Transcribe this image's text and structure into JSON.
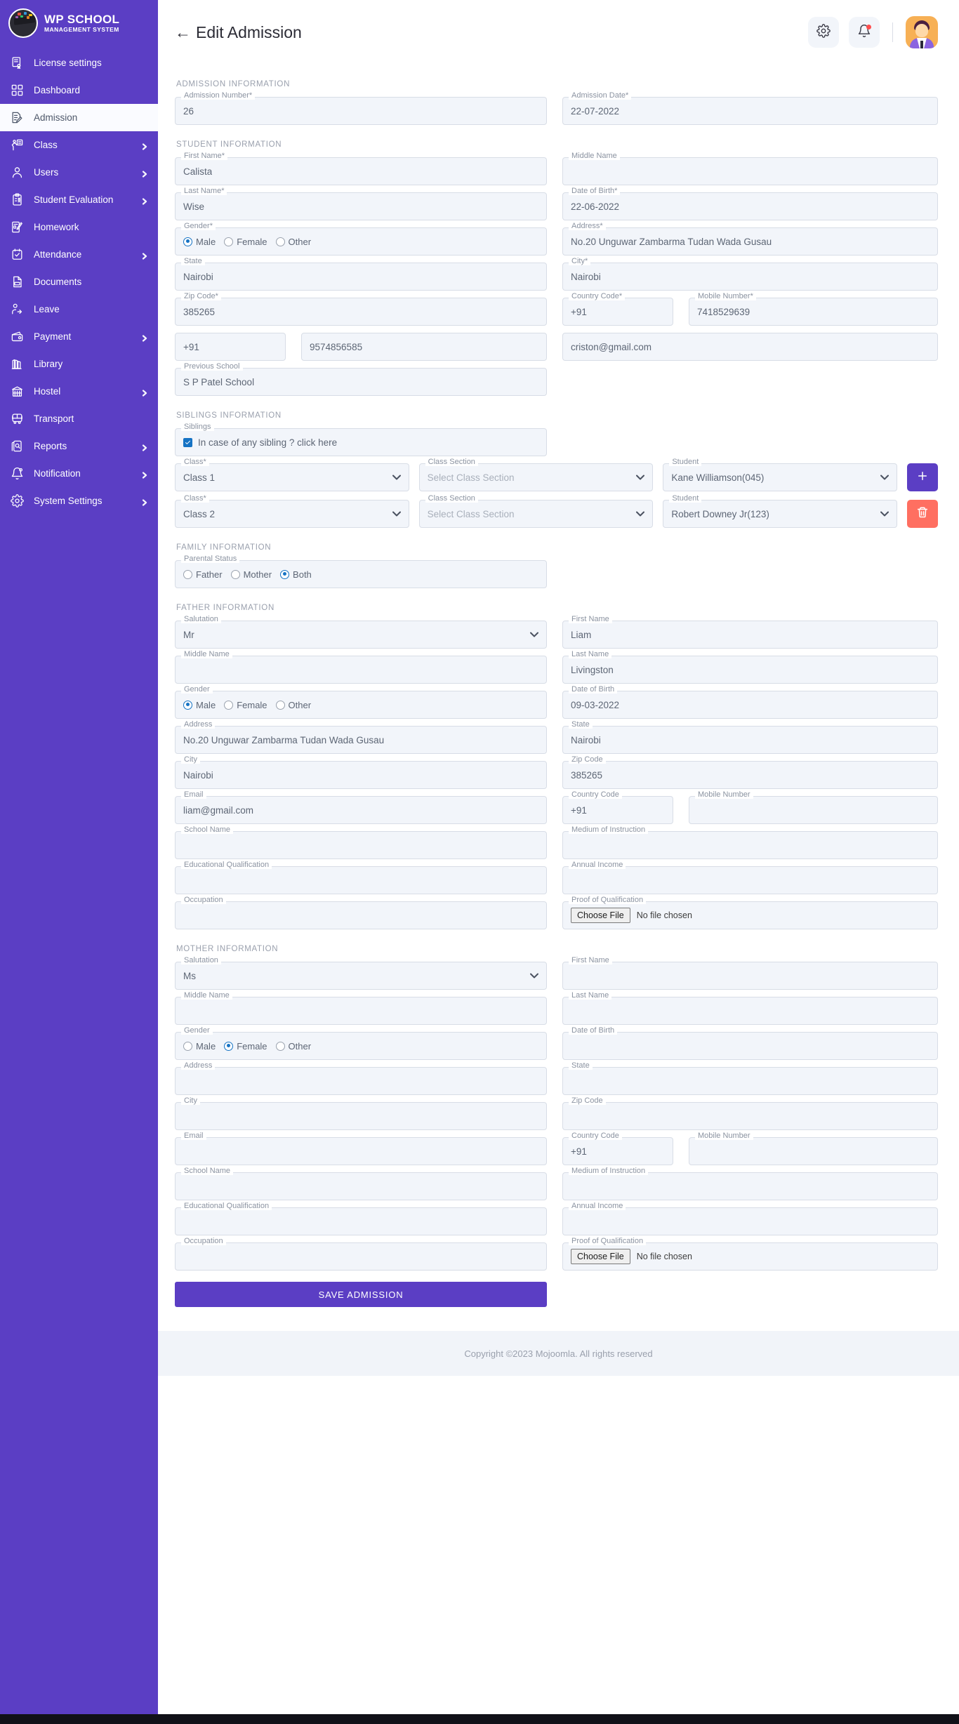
{
  "brand": {
    "title": "WP SCHOOL",
    "subtitle": "MANAGEMENT SYSTEM"
  },
  "sidebar": {
    "items": [
      {
        "label": "License settings",
        "icon": "certificate-icon",
        "chevron": false,
        "active": false
      },
      {
        "label": "Dashboard",
        "icon": "grid-icon",
        "chevron": false,
        "active": false
      },
      {
        "label": "Admission",
        "icon": "admission-form-icon",
        "chevron": false,
        "active": true
      },
      {
        "label": "Class",
        "icon": "class-icon",
        "chevron": true,
        "active": false
      },
      {
        "label": "Users",
        "icon": "user-icon",
        "chevron": true,
        "active": false
      },
      {
        "label": "Student Evaluation",
        "icon": "clipboard-check-icon",
        "chevron": true,
        "active": false
      },
      {
        "label": "Homework",
        "icon": "homework-icon",
        "chevron": false,
        "active": false
      },
      {
        "label": "Attendance",
        "icon": "attendance-icon",
        "chevron": true,
        "active": false
      },
      {
        "label": "Documents",
        "icon": "document-icon",
        "chevron": false,
        "active": false
      },
      {
        "label": "Leave",
        "icon": "leave-icon",
        "chevron": false,
        "active": false
      },
      {
        "label": "Payment",
        "icon": "wallet-icon",
        "chevron": true,
        "active": false
      },
      {
        "label": "Library",
        "icon": "library-icon",
        "chevron": false,
        "active": false
      },
      {
        "label": "Hostel",
        "icon": "hostel-icon",
        "chevron": true,
        "active": false
      },
      {
        "label": "Transport",
        "icon": "bus-icon",
        "chevron": false,
        "active": false
      },
      {
        "label": "Reports",
        "icon": "reports-icon",
        "chevron": true,
        "active": false
      },
      {
        "label": "Notification",
        "icon": "bell-icon",
        "chevron": true,
        "active": false
      },
      {
        "label": "System Settings",
        "icon": "gear-icon",
        "chevron": true,
        "active": false
      }
    ]
  },
  "header": {
    "title": "Edit Admission",
    "back_arrow": "←",
    "settings_icon": "gear-icon",
    "notification_icon": "bell-icon",
    "avatar": "user-avatar"
  },
  "sections": {
    "admission": "ADMISSION INFORMATION",
    "student": "STUDENT INFORMATION",
    "siblings": "SIBLINGS INFORMATION",
    "family": "FAMILY INFORMATION",
    "father": "FATHER INFORMATION",
    "mother": "MOTHER INFORMATION"
  },
  "admission": {
    "number_label": "Admission Number*",
    "number_value": "26",
    "date_label": "Admission Date*",
    "date_value": "22-07-2022"
  },
  "student": {
    "first_name_label": "First Name*",
    "first_name_value": "Calista",
    "middle_name_label": "Middle Name",
    "middle_name_value": "",
    "last_name_label": "Last Name*",
    "last_name_value": "Wise",
    "dob_label": "Date of Birth*",
    "dob_value": "22-06-2022",
    "gender_label": "Gender*",
    "gender_options": [
      "Male",
      "Female",
      "Other"
    ],
    "gender_selected": "Male",
    "address_label": "Address*",
    "address_value": "No.20 Unguwar Zambarma Tudan Wada Gusau",
    "state_label": "State",
    "state_value": "Nairobi",
    "city_label": "City*",
    "city_value": "Nairobi",
    "zip_label": "Zip Code*",
    "zip_value": "385265",
    "country_code_label": "Country Code*",
    "country_code_value": "+91",
    "mobile_label": "Mobile Number*",
    "mobile_value": "7418529639",
    "alt_country_code_value": "+91",
    "alt_phone_value": "9574856585",
    "email_value": "criston@gmail.com",
    "prev_school_label": "Previous School",
    "prev_school_value": "S P Patel School"
  },
  "siblings": {
    "checkbox_legend": "Siblings",
    "checkbox_label": "In case of any sibling ? click here",
    "checked": true,
    "class_label": "Class*",
    "section_label": "Class Section",
    "student_label": "Student",
    "section_placeholder": "Select Class Section",
    "rows": [
      {
        "class_value": "Class 1",
        "section_value": "Select Class Section",
        "student_value": "Kane Williamson(045)",
        "action": "add"
      },
      {
        "class_value": "Class 2",
        "section_value": "Select Class Section",
        "student_value": "Robert Downey Jr(123)",
        "action": "delete"
      }
    ],
    "add_icon": "plus-icon",
    "delete_icon": "trash-icon"
  },
  "family": {
    "parental_status_label": "Parental Status",
    "options": [
      "Father",
      "Mother",
      "Both"
    ],
    "selected": "Both"
  },
  "father": {
    "salutation_label": "Salutation",
    "salutation_value": "Mr",
    "first_name_label": "First Name",
    "first_name_value": "Liam",
    "middle_name_label": "Middle Name",
    "middle_name_value": "",
    "last_name_label": "Last Name",
    "last_name_value": "Livingston",
    "gender_label": "Gender",
    "gender_options": [
      "Male",
      "Female",
      "Other"
    ],
    "gender_selected": "Male",
    "dob_label": "Date of Birth",
    "dob_value": "09-03-2022",
    "address_label": "Address",
    "address_value": "No.20 Unguwar Zambarma Tudan Wada Gusau",
    "state_label": "State",
    "state_value": "Nairobi",
    "city_label": "City",
    "city_value": "Nairobi",
    "zip_label": "Zip Code",
    "zip_value": "385265",
    "email_label": "Email",
    "email_value": "liam@gmail.com",
    "country_code_label": "Country Code",
    "country_code_value": "+91",
    "mobile_label": "Mobile Number",
    "mobile_value": "",
    "school_name_label": "School Name",
    "school_name_value": "",
    "medium_label": "Medium of Instruction",
    "medium_value": "",
    "edu_label": "Educational Qualification",
    "edu_value": "",
    "income_label": "Annual Income",
    "income_value": "",
    "occupation_label": "Occupation",
    "occupation_value": "",
    "proof_label": "Proof of Qualification",
    "choose_file": "Choose File",
    "no_file": "No file chosen"
  },
  "mother": {
    "salutation_label": "Salutation",
    "salutation_value": "Ms",
    "first_name_label": "First Name",
    "first_name_value": "",
    "middle_name_label": "Middle Name",
    "middle_name_value": "",
    "last_name_label": "Last Name",
    "last_name_value": "",
    "gender_label": "Gender",
    "gender_options": [
      "Male",
      "Female",
      "Other"
    ],
    "gender_selected": "Female",
    "dob_label": "Date of Birth",
    "dob_value": "",
    "address_label": "Address",
    "address_value": "",
    "state_label": "State",
    "state_value": "",
    "city_label": "City",
    "city_value": "",
    "zip_label": "Zip Code",
    "zip_value": "",
    "email_label": "Email",
    "email_value": "",
    "country_code_label": "Country Code",
    "country_code_value": "+91",
    "mobile_label": "Mobile Number",
    "mobile_value": "",
    "school_name_label": "School Name",
    "school_name_value": "",
    "medium_label": "Medium of Instruction",
    "medium_value": "",
    "edu_label": "Educational Qualification",
    "edu_value": "",
    "income_label": "Annual Income",
    "income_value": "",
    "occupation_label": "Occupation",
    "occupation_value": "",
    "proof_label": "Proof of Qualification",
    "choose_file": "Choose File",
    "no_file": "No file chosen"
  },
  "save_button": "SAVE ADMISSION",
  "footer": "Copyright ©2023 Mojoomla. All rights reserved",
  "colors": {
    "brand_purple": "#5b3ec4",
    "danger_red": "#ff6f61",
    "accent_blue": "#1673c4",
    "field_bg": "#f2f5fa"
  }
}
